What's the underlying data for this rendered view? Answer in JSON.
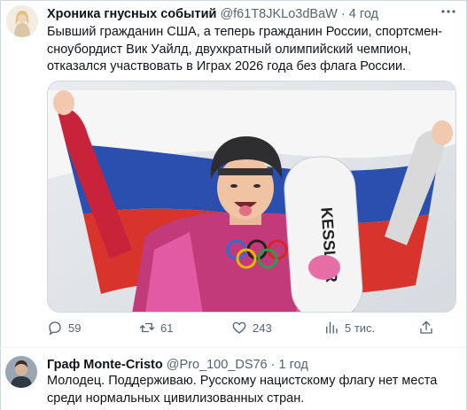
{
  "tweet": {
    "author": {
      "name": "Хроника гнусных событий",
      "handle": "@f61T8JKLo3dBaW",
      "separator": "·",
      "time": "4 год"
    },
    "text": "Бывший гражданин США, а теперь гражданин России, спортсмен-сноубордист Вик Уайлд, двухкратный олимпийский чемпион,  отказался участвовать в Играх 2026 года без флага России.",
    "media": {
      "board_text": "KESSLER",
      "rings_colors": [
        "#2a6fd6",
        "#e5b800",
        "#222222",
        "#2a9d4a",
        "#d8232a"
      ]
    },
    "actions": {
      "reply": {
        "icon": "reply-icon",
        "count": "59"
      },
      "retweet": {
        "icon": "retweet-icon",
        "count": "61"
      },
      "like": {
        "icon": "heart-icon",
        "count": "243"
      },
      "views": {
        "icon": "views-icon",
        "count": "5 тис."
      },
      "share": {
        "icon": "share-icon"
      }
    }
  },
  "reply": {
    "author": {
      "name": "Граф Monte-Cristo",
      "handle": "@Pro_100_DS76",
      "separator": "·",
      "time": "1 год"
    },
    "text": "Молодец. Поддерживаю. Русскому нацистскому флагу нет места среди нормальных цивилизованных стран."
  },
  "colors": {
    "text": "#0f1419",
    "secondary": "#536471",
    "border": "#cfd9de"
  }
}
